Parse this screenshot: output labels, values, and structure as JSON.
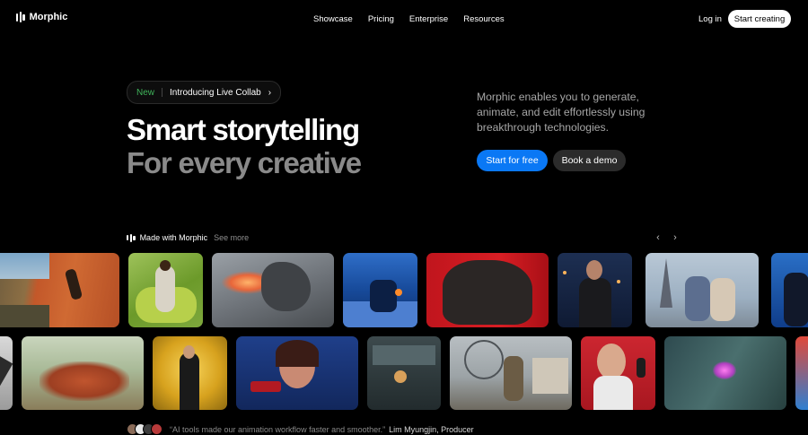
{
  "nav": {
    "brand": "Morphic",
    "links": [
      "Showcase",
      "Pricing",
      "Enterprise",
      "Resources"
    ],
    "login": "Log in",
    "cta": "Start creating"
  },
  "hero": {
    "badge_new": "New",
    "badge_text": "Introducing Live Collab",
    "badge_chevron": "›",
    "title_line1": "Smart storytelling",
    "title_line2": "For every creative",
    "description": "Morphic enables you to generate, animate, and edit effortlessly using breakthrough technologies.",
    "primary_button": "Start for free",
    "secondary_button": "Book a demo"
  },
  "gallery": {
    "label": "Made with Morphic",
    "see_more": "See more",
    "prev_icon": "‹",
    "next_icon": "›"
  },
  "testimonial": {
    "quote": "“AI tools made our animation workflow faster and smoother.”",
    "author": "Lim Myungjin, Producer"
  },
  "icons": [
    "morphic-logo-icon",
    "chevron-right-icon",
    "chevron-left-icon"
  ]
}
